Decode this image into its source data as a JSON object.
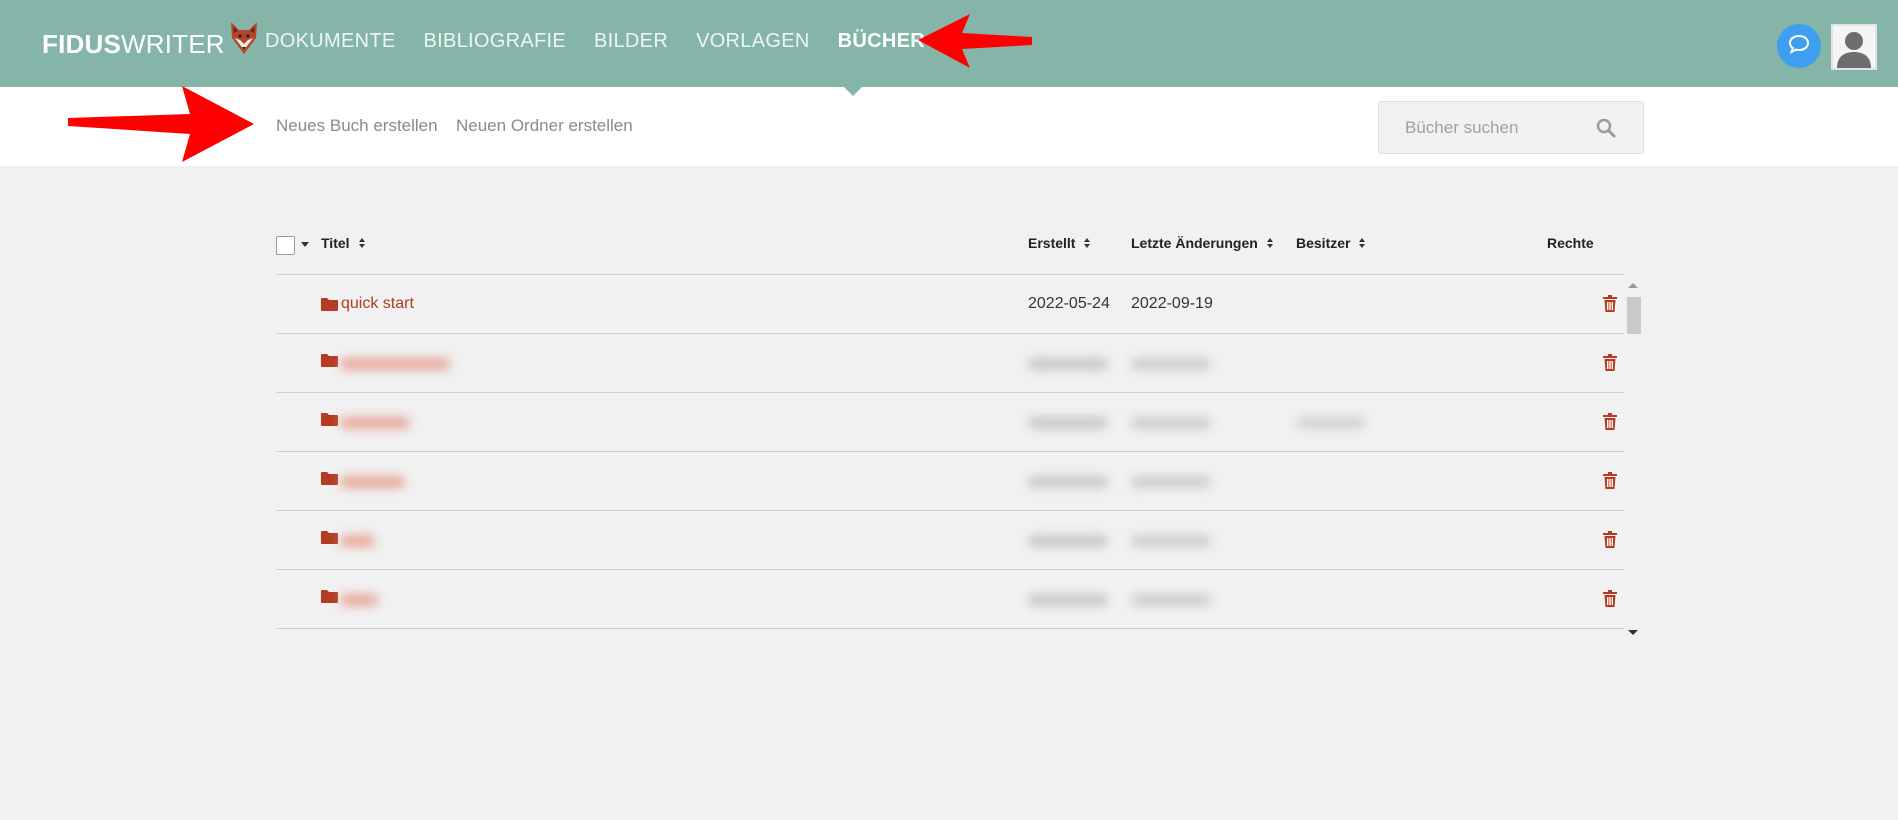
{
  "brand": {
    "bold": "FIDUS",
    "light": "WRITER"
  },
  "nav": {
    "items": [
      {
        "label": "DOKUMENTE"
      },
      {
        "label": "BIBLIOGRAFIE"
      },
      {
        "label": "BILDER"
      },
      {
        "label": "VORLAGEN"
      },
      {
        "label": "BÜCHER",
        "active": true
      }
    ]
  },
  "actions": {
    "new_book": "Neues Buch erstellen",
    "new_folder": "Neuen Ordner erstellen"
  },
  "search": {
    "placeholder": "Bücher suchen"
  },
  "table": {
    "columns": {
      "title": "Titel",
      "created": "Erstellt",
      "modified": "Letzte Änderungen",
      "owner": "Besitzer",
      "rights": "Rechte"
    },
    "rows": [
      {
        "title": "quick start",
        "created": "2022-05-24",
        "modified": "2022-09-19",
        "owner": ""
      },
      {
        "title": "",
        "created": "",
        "modified": "",
        "owner": "",
        "redacted": true
      },
      {
        "title": "",
        "created": "",
        "modified": "",
        "owner": "",
        "redacted": true
      },
      {
        "title": "",
        "created": "",
        "modified": "",
        "owner": "",
        "redacted": true
      },
      {
        "title": "",
        "created": "",
        "modified": "",
        "owner": "",
        "redacted": true
      },
      {
        "title": "",
        "created": "",
        "modified": "",
        "owner": "",
        "redacted": true
      }
    ]
  },
  "colors": {
    "header": "#84b5a8",
    "accent": "#b53a22",
    "chat": "#3e9ff0",
    "annotation_arrow": "#ff0000"
  },
  "icons": [
    "fox-logo-icon",
    "chat-icon",
    "user-avatar-icon",
    "search-icon",
    "folder-icon",
    "trash-icon",
    "sort-icon",
    "annotation-arrow-icon"
  ]
}
